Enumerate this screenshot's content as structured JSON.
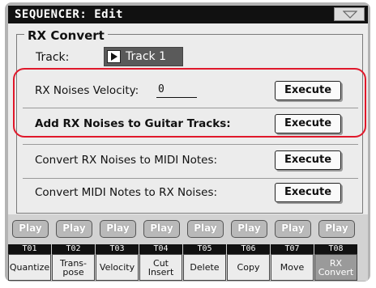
{
  "window": {
    "title": "SEQUENCER: Edit"
  },
  "section": {
    "title": "RX Convert"
  },
  "track": {
    "label": "Track:",
    "value": "Track 1"
  },
  "rows": [
    {
      "label": "RX Noises Velocity:",
      "value": "0",
      "button": "Execute"
    },
    {
      "label": "Add RX Noises to Guitar Tracks:",
      "button": "Execute"
    },
    {
      "label": "Convert RX Noises to MIDI Notes:",
      "button": "Execute"
    },
    {
      "label": "Convert MIDI Notes to RX Noises:",
      "button": "Execute"
    }
  ],
  "play_label": "Play",
  "tracks": [
    "T01",
    "T02",
    "T03",
    "T04",
    "T05",
    "T06",
    "T07",
    "T08"
  ],
  "tabs": [
    "Quantize",
    "Trans-\npose",
    "Velocity",
    "Cut\nInsert",
    "Delete",
    "Copy",
    "Move",
    "RX\nConvert"
  ],
  "active_tab": "RX\nConvert",
  "colors": {
    "highlight": "#e0182b",
    "title_bar": "#111111",
    "track_field": "#5a5a5a"
  }
}
